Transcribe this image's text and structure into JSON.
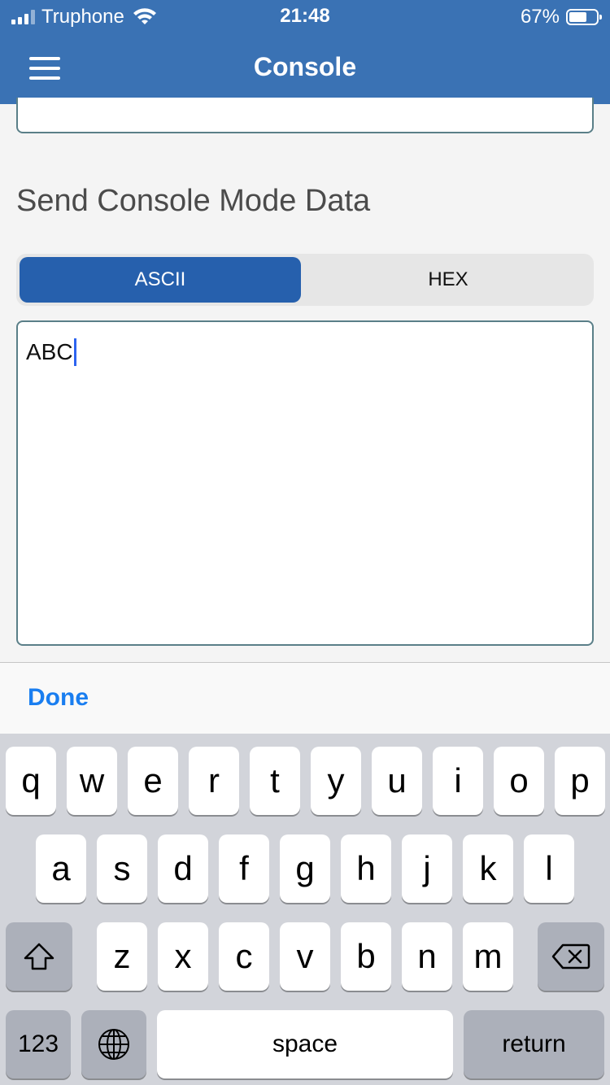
{
  "status_bar": {
    "carrier": "Truphone",
    "time": "21:48",
    "battery_percent": "67%",
    "battery_level": 0.67,
    "signal_bars_filled": 3,
    "signal_bars_total": 4
  },
  "nav": {
    "title": "Console",
    "menu_icon": "hamburger-menu-icon"
  },
  "section": {
    "title": "Send Console Mode Data"
  },
  "segmented_control": {
    "options": [
      "ASCII",
      "HEX"
    ],
    "selected": "ASCII"
  },
  "input": {
    "value": "ABC"
  },
  "toolbar": {
    "done_label": "Done"
  },
  "keyboard": {
    "row1": [
      "q",
      "w",
      "e",
      "r",
      "t",
      "y",
      "u",
      "i",
      "o",
      "p"
    ],
    "row2": [
      "a",
      "s",
      "d",
      "f",
      "g",
      "h",
      "j",
      "k",
      "l"
    ],
    "row3": [
      "z",
      "x",
      "c",
      "v",
      "b",
      "n",
      "m"
    ],
    "numbers_label": "123",
    "space_label": "space",
    "return_label": "return",
    "shift_icon": "shift-icon",
    "backspace_icon": "backspace-icon",
    "globe_icon": "globe-icon"
  },
  "colors": {
    "nav_background": "#3a72b4",
    "segment_selected": "#2660ad",
    "done_blue": "#1a7ef0",
    "caret_blue": "#2d64f0"
  }
}
